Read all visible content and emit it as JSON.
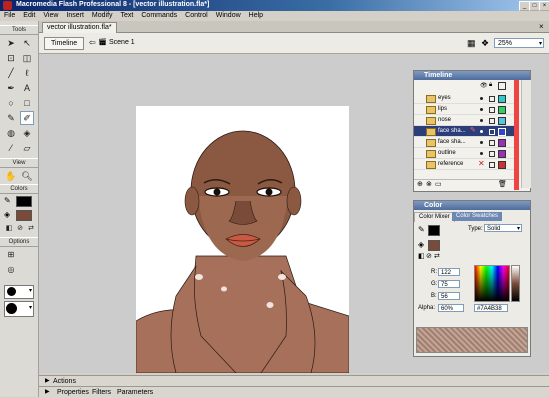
{
  "window": {
    "title": "Macromedia Flash Professional 8 - [vector illustration.fla*]"
  },
  "menu": [
    "File",
    "Edit",
    "View",
    "Insert",
    "Modify",
    "Text",
    "Commands",
    "Control",
    "Window",
    "Help"
  ],
  "tools": {
    "header": "Tools",
    "view_header": "View",
    "colors_header": "Colors",
    "options_header": "Options"
  },
  "document": {
    "tab": "vector illustration.fla*",
    "timeline_button": "Timeline",
    "scene": "Scene 1",
    "zoom": "25%"
  },
  "timeline": {
    "title": "Timeline",
    "layers": [
      {
        "name": "eyes",
        "color": "#34c9c9",
        "selected": false
      },
      {
        "name": "lips",
        "color": "#33cc66",
        "selected": false
      },
      {
        "name": "nose",
        "color": "#5ac3e0",
        "selected": false
      },
      {
        "name": "face sha...",
        "color": "#3344cc",
        "selected": true
      },
      {
        "name": "face sha...",
        "color": "#9b2fb5",
        "selected": false
      },
      {
        "name": "outline",
        "color": "#9b2fb5",
        "selected": false
      },
      {
        "name": "reference",
        "color": "#cc3333",
        "selected": false
      }
    ]
  },
  "color_panel": {
    "title": "Color",
    "tabs": [
      "Color Mixer",
      "Color Swatches"
    ],
    "type_label": "Type:",
    "type_value": "Solid",
    "r_label": "R:",
    "r": "122",
    "g_label": "G:",
    "g": "75",
    "b_label": "B:",
    "b": "56",
    "alpha_label": "Alpha:",
    "alpha": "60%",
    "hex": "#7A4B38",
    "swatch_color": "#7a4b38"
  },
  "bottom": {
    "actions": "Actions",
    "tabs": [
      "Properties",
      "Filters",
      "Parameters"
    ]
  }
}
